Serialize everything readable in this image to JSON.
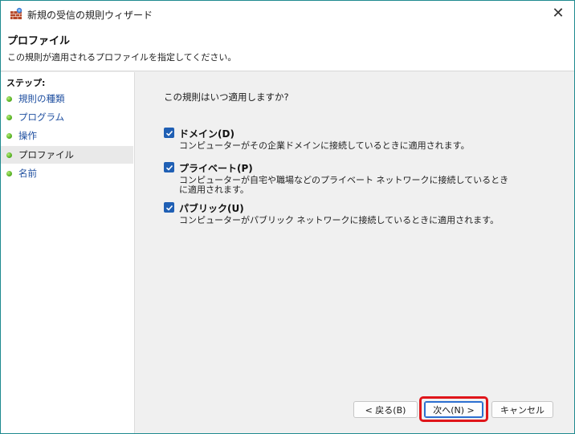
{
  "window": {
    "title": "新規の受信の規則ウィザード",
    "close_glyph": "✕"
  },
  "header": {
    "title": "プロファイル",
    "description": "この規則が適用されるプロファイルを指定してください。"
  },
  "steps": {
    "heading": "ステップ:",
    "items": [
      {
        "label": "規則の種類",
        "active": false
      },
      {
        "label": "プログラム",
        "active": false
      },
      {
        "label": "操作",
        "active": false
      },
      {
        "label": "プロファイル",
        "active": true
      },
      {
        "label": "名前",
        "active": false
      }
    ]
  },
  "content": {
    "question": "この規則はいつ適用しますか?",
    "options": [
      {
        "label": "ドメイン(D)",
        "checked": true,
        "description": "コンピューターがその企業ドメインに接続しているときに適用されます。"
      },
      {
        "label": "プライベート(P)",
        "checked": true,
        "description": "コンピューターが自宅や職場などのプライベート ネットワークに接続しているときに適用されます。"
      },
      {
        "label": "パブリック(U)",
        "checked": true,
        "description": "コンピューターがパブリック ネットワークに接続しているときに適用されます。"
      }
    ]
  },
  "buttons": {
    "back": "< 戻る(B)",
    "next": "次へ(N) >",
    "cancel": "キャンセル"
  },
  "colors": {
    "checkbox": "#1f5fb4",
    "highlight": "#e0151a",
    "step_dot": "#5fb82a",
    "step_link": "#1f4fa0"
  },
  "icons": {
    "app": "firewall-wall-icon",
    "close": "close-icon",
    "step": "green-bullet-icon",
    "check": "checkmark-icon"
  }
}
